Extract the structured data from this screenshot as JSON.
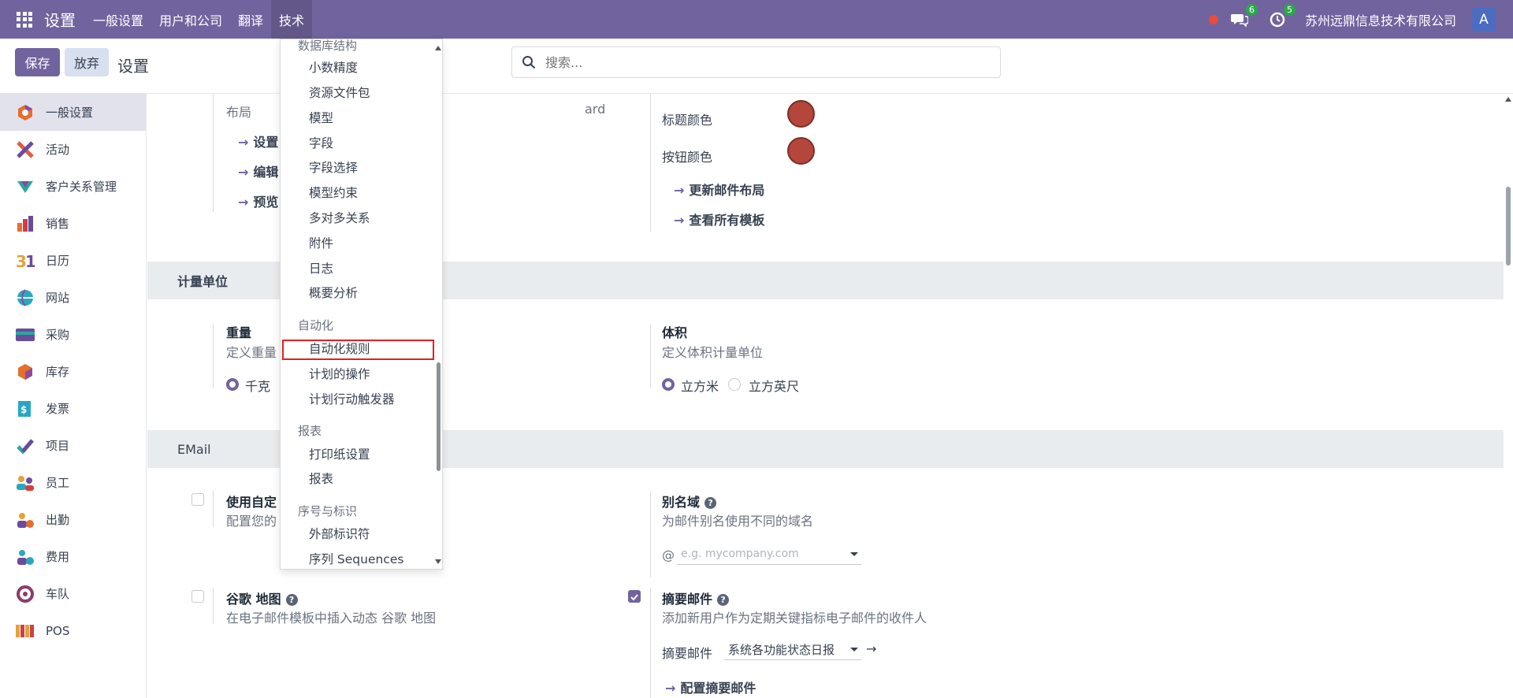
{
  "navbar": {
    "brand": "设置",
    "menu": [
      "一般设置",
      "用户和公司",
      "翻译",
      "技术"
    ],
    "messages_count": "6",
    "activities_count": "5",
    "company": "苏州远鼎信息技术有限公司",
    "avatar_letter": "A"
  },
  "control": {
    "save": "保存",
    "discard": "放弃",
    "title": "设置",
    "search_placeholder": "搜索..."
  },
  "sidebar": {
    "items": [
      "一般设置",
      "活动",
      "客户关系管理",
      "销售",
      "日历",
      "网站",
      "采购",
      "库存",
      "发票",
      "项目",
      "员工",
      "出勤",
      "费用",
      "车队",
      "POS"
    ]
  },
  "layout_section": {
    "label": "布局",
    "link1": "设置",
    "link2": "编辑",
    "link3": "预览",
    "partial_text": "ard",
    "title_color_label": "标题颜色",
    "button_color_label": "按钮颜色",
    "update_layout": "更新邮件布局",
    "view_templates": "查看所有模板",
    "color": "#b5463c"
  },
  "uom_section": {
    "header": "计量单位",
    "weight_title": "重量",
    "weight_desc": "定义重量",
    "weight_opt": "千克",
    "volume_title": "体积",
    "volume_desc": "定义体积计量单位",
    "volume_opt1": "立方米",
    "volume_opt2": "立方英尺"
  },
  "email_section": {
    "header": "EMail",
    "custom_title": "使用自定",
    "custom_desc": "配置您的",
    "alias_title": "别名域",
    "alias_desc": "为邮件别名使用不同的域名",
    "alias_at": "@",
    "alias_placeholder": "e.g. mycompany.com",
    "maps_title": "谷歌 地图",
    "maps_desc": "在电子邮件模板中插入动态 谷歌 地图",
    "digest_title": "摘要邮件",
    "digest_desc": "添加新用户作为定期关键指标电子邮件的收件人",
    "digest_label": "摘要邮件",
    "digest_value": "系统各功能状态日报",
    "configure_digest": "配置摘要邮件"
  },
  "dropdown": {
    "top_header": "数据库结构",
    "db_items": [
      "小数精度",
      "资源文件包",
      "模型",
      "字段",
      "字段选择",
      "模型约束",
      "多对多关系",
      "附件",
      "日志",
      "概要分析"
    ],
    "automation_header": "自动化",
    "automation_items": [
      "自动化规则",
      "计划的操作",
      "计划行动触发器"
    ],
    "reports_header": "报表",
    "reports_items": [
      "打印纸设置",
      "报表"
    ],
    "seq_header": "序号与标识",
    "seq_items": [
      "外部标识符",
      "序列 Sequences"
    ]
  }
}
